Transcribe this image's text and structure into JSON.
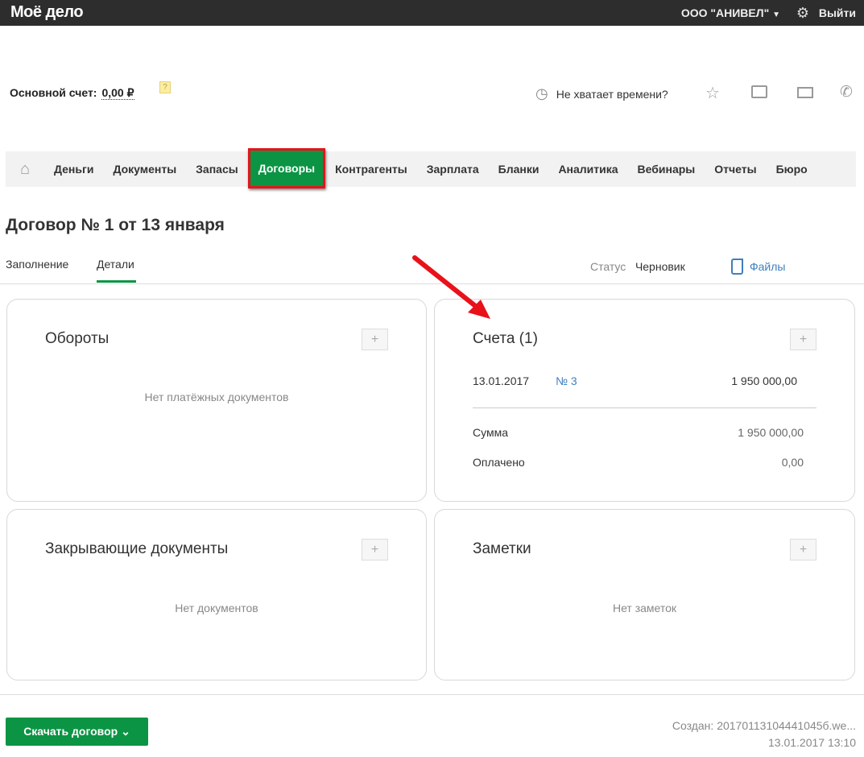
{
  "header": {
    "logo": "Моё дело",
    "org": "ООО \"АНИВЕЛ\"",
    "logout": "Выйти"
  },
  "account": {
    "label": "Основной счет:",
    "value": "0,00 ₽",
    "help": "?"
  },
  "toolbar": {
    "time_prompt": "Не хватает времени?"
  },
  "nav": {
    "items": [
      "Деньги",
      "Документы",
      "Запасы",
      "Договоры",
      "Контрагенты",
      "Зарплата",
      "Бланки",
      "Аналитика",
      "Вебинары",
      "Отчеты",
      "Бюро"
    ],
    "active": "Договоры"
  },
  "page": {
    "title": "Договор № 1 от 13 января",
    "tabs": [
      "Заполнение",
      "Детали"
    ],
    "active_tab": "Детали",
    "status_label": "Статус",
    "status_value": "Черновик",
    "files": "Файлы"
  },
  "cards": {
    "turnover": {
      "title": "Обороты",
      "empty": "Нет платёжных документов"
    },
    "invoices": {
      "title": "Счета (1)",
      "row": {
        "date": "13.01.2017",
        "number": "№ 3",
        "amount": "1 950 000,00"
      },
      "sum_label": "Сумма",
      "sum_value": "1 950 000,00",
      "paid_label": "Оплачено",
      "paid_value": "0,00"
    },
    "closing": {
      "title": "Закрывающие документы",
      "empty": "Нет документов"
    },
    "notes": {
      "title": "Заметки",
      "empty": "Нет заметок"
    }
  },
  "footer": {
    "download": "Скачать договор",
    "created": "Создан: 20170113104441045б.we...",
    "date": "13.01.2017 13:10"
  },
  "colors": {
    "brand_green": "#0b9444",
    "highlight_red": "#e8121a",
    "link": "#3f7fbf"
  }
}
